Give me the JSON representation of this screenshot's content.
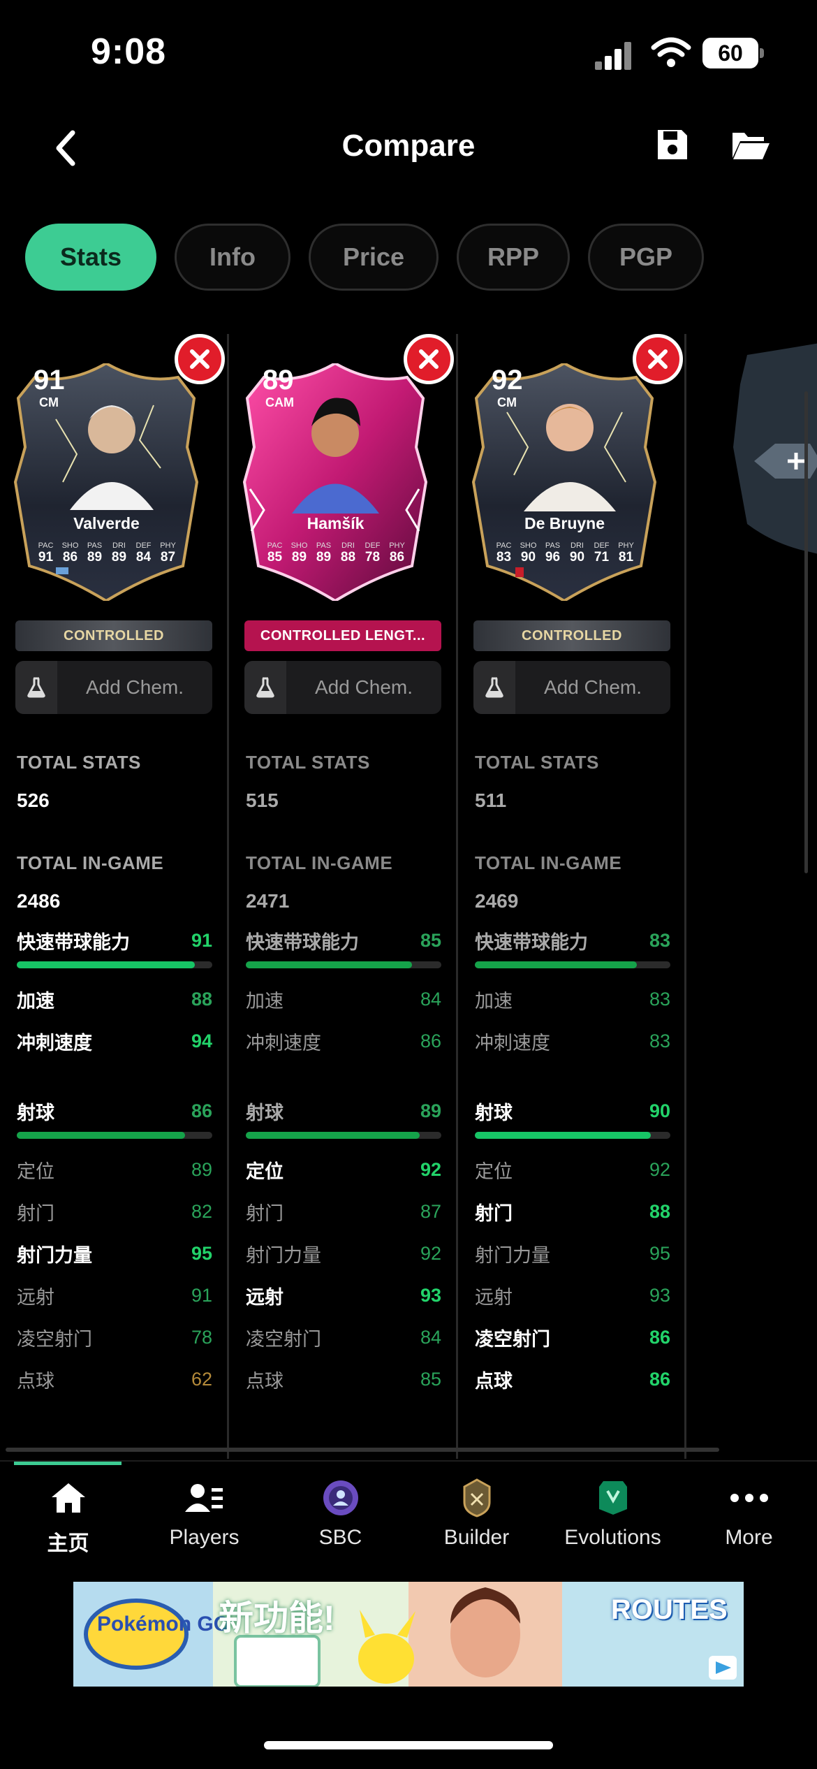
{
  "status_bar": {
    "time": "9:08",
    "battery": "60"
  },
  "header": {
    "title": "Compare"
  },
  "tabs": [
    {
      "label": "Stats",
      "active": true
    },
    {
      "label": "Info",
      "active": false
    },
    {
      "label": "Price",
      "active": false
    },
    {
      "label": "RPP",
      "active": false
    },
    {
      "label": "PGP",
      "active": false
    }
  ],
  "players": [
    {
      "name": "Valverde",
      "rating": "91",
      "position": "CM",
      "card_stats": [
        "91",
        "86",
        "89",
        "89",
        "84",
        "87"
      ],
      "chem_style": "CONTROLLED",
      "add_chem": "Add Chem.",
      "total_stats_label": "TOTAL STATS",
      "total_stats": "526",
      "total_ingame_label": "TOTAL IN-GAME",
      "total_ingame": "2486",
      "pace": {
        "label": "快速带球能力",
        "value": "91",
        "fill": 0.91
      },
      "pace_sub": [
        {
          "label": "加速",
          "value": "88"
        },
        {
          "label": "冲刺速度",
          "value": "94"
        }
      ],
      "shooting": {
        "label": "射球",
        "value": "86",
        "fill": 0.86
      },
      "shooting_sub": [
        {
          "label": "定位",
          "value": "89"
        },
        {
          "label": "射门",
          "value": "82"
        },
        {
          "label": "射门力量",
          "value": "95"
        },
        {
          "label": "远射",
          "value": "91"
        },
        {
          "label": "凌空射门",
          "value": "78"
        },
        {
          "label": "点球",
          "value": "62"
        }
      ]
    },
    {
      "name": "Hamšík",
      "rating": "89",
      "position": "CAM",
      "card_stats": [
        "85",
        "89",
        "89",
        "88",
        "78",
        "86"
      ],
      "chem_style": "CONTROLLED LENGT...",
      "add_chem": "Add Chem.",
      "total_stats_label": "TOTAL STATS",
      "total_stats": "515",
      "total_ingame_label": "TOTAL IN-GAME",
      "total_ingame": "2471",
      "pace": {
        "label": "快速带球能力",
        "value": "85",
        "fill": 0.85
      },
      "pace_sub": [
        {
          "label": "加速",
          "value": "84"
        },
        {
          "label": "冲刺速度",
          "value": "86"
        }
      ],
      "shooting": {
        "label": "射球",
        "value": "89",
        "fill": 0.89
      },
      "shooting_sub": [
        {
          "label": "定位",
          "value": "92"
        },
        {
          "label": "射门",
          "value": "87"
        },
        {
          "label": "射门力量",
          "value": "92"
        },
        {
          "label": "远射",
          "value": "93"
        },
        {
          "label": "凌空射门",
          "value": "84"
        },
        {
          "label": "点球",
          "value": "85"
        }
      ]
    },
    {
      "name": "De Bruyne",
      "rating": "92",
      "position": "CM",
      "card_stats": [
        "83",
        "90",
        "96",
        "90",
        "71",
        "81"
      ],
      "chem_style": "CONTROLLED",
      "add_chem": "Add Chem.",
      "total_stats_label": "TOTAL STATS",
      "total_stats": "511",
      "total_ingame_label": "TOTAL IN-GAME",
      "total_ingame": "2469",
      "pace": {
        "label": "快速带球能力",
        "value": "83",
        "fill": 0.83
      },
      "pace_sub": [
        {
          "label": "加速",
          "value": "83"
        },
        {
          "label": "冲刺速度",
          "value": "83"
        }
      ],
      "shooting": {
        "label": "射球",
        "value": "90",
        "fill": 0.9
      },
      "shooting_sub": [
        {
          "label": "定位",
          "value": "92"
        },
        {
          "label": "射门",
          "value": "88"
        },
        {
          "label": "射门力量",
          "value": "95"
        },
        {
          "label": "远射",
          "value": "93"
        },
        {
          "label": "凌空射门",
          "value": "86"
        },
        {
          "label": "点球",
          "value": "86"
        }
      ]
    }
  ],
  "card_stat_labels": [
    "PAC",
    "SHO",
    "PAS",
    "DRI",
    "DEF",
    "PHY"
  ],
  "tab_bar": [
    {
      "label": "主页",
      "icon": "home-icon"
    },
    {
      "label": "Players",
      "icon": "players-icon"
    },
    {
      "label": "SBC",
      "icon": "sbc-icon"
    },
    {
      "label": "Builder",
      "icon": "builder-icon"
    },
    {
      "label": "Evolutions",
      "icon": "evolutions-icon"
    },
    {
      "label": "More",
      "icon": "more-icon"
    }
  ],
  "ad": {
    "brand": "Pokémon GO",
    "headline": "新功能!",
    "tag": "ROUTES"
  }
}
